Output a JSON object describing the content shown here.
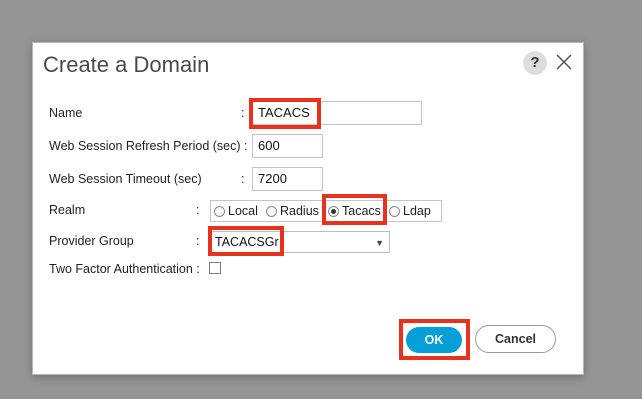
{
  "dialog": {
    "title": "Create a Domain",
    "help_label": "?",
    "close_icon": "close-icon"
  },
  "form": {
    "name": {
      "label": "Name",
      "colon": ":",
      "value": "TACACS"
    },
    "refresh": {
      "label": "Web Session Refresh Period (sec) :",
      "value": "600"
    },
    "timeout": {
      "label": "Web Session Timeout (sec)",
      "colon": ":",
      "value": "7200"
    },
    "realm": {
      "label": "Realm",
      "colon": ":",
      "options": [
        "Local",
        "Radius",
        "Tacacs",
        "Ldap"
      ],
      "selected": "Tacacs"
    },
    "provider_group": {
      "label": "Provider Group",
      "colon": ":",
      "value": "TACACSGr"
    },
    "two_factor": {
      "label": "Two Factor Authentication :",
      "checked": false
    }
  },
  "buttons": {
    "ok": "OK",
    "cancel": "Cancel"
  },
  "colors": {
    "highlight": "#e8321e",
    "primary": "#049fd9",
    "backdrop": "#959595"
  }
}
